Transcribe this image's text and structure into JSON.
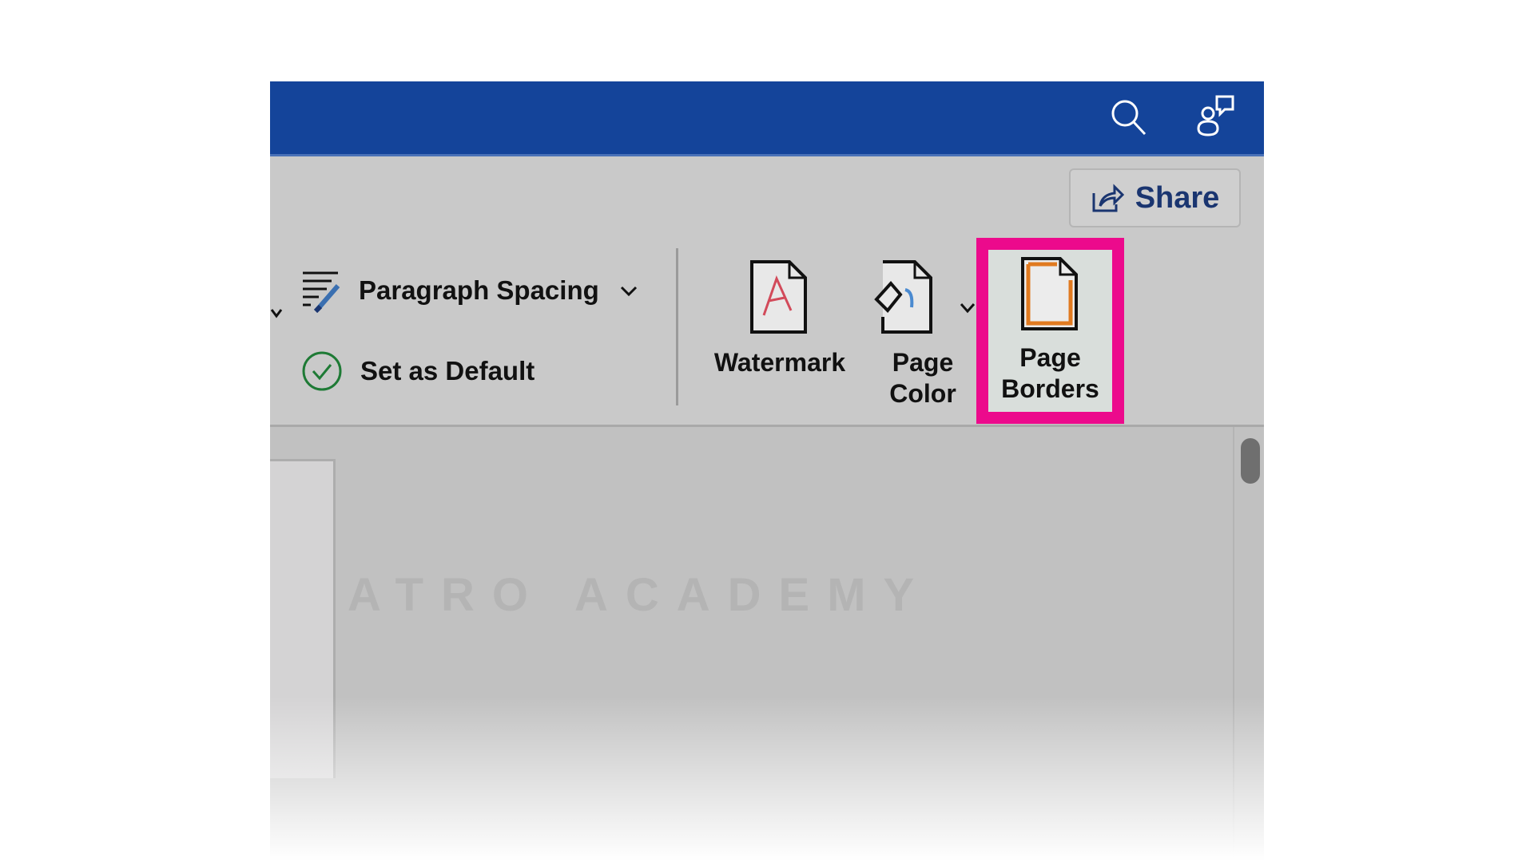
{
  "titlebar": {
    "icons": [
      "search-icon",
      "people-chat-icon"
    ]
  },
  "share": {
    "label": "Share",
    "icon": "share-icon"
  },
  "ribbon": {
    "paragraph_spacing": {
      "label": "Paragraph Spacing",
      "icon": "paragraph-spacing-icon"
    },
    "set_as_default": {
      "label": "Set as Default",
      "icon": "check-circle-icon"
    },
    "watermark": {
      "label": "Watermark"
    },
    "page_color": {
      "line1": "Page",
      "line2": "Color"
    },
    "page_borders": {
      "line1": "Page",
      "line2": "Borders"
    }
  },
  "highlight_color": "#ec0a8c",
  "brand_color": "#14449a",
  "watermark_logo": "ATRO ACADEMY"
}
